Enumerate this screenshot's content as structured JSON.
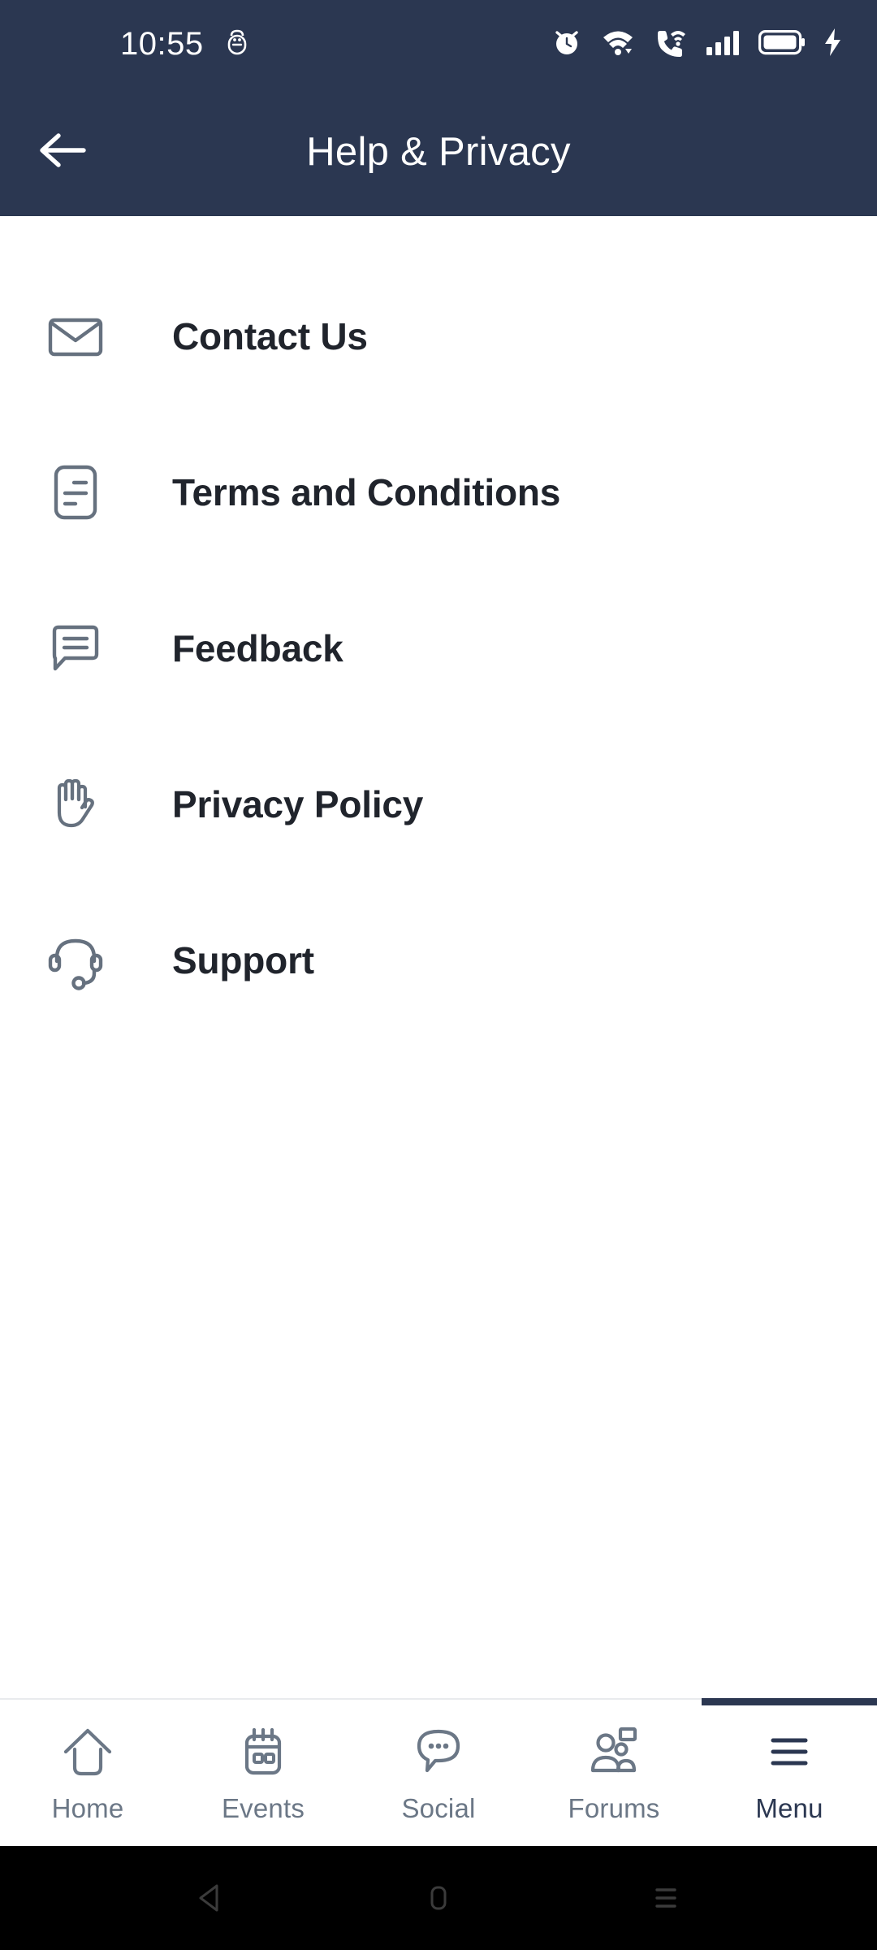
{
  "status_bar": {
    "time": "10:55",
    "icons": [
      {
        "name": "android-debug-icon"
      },
      {
        "name": "alarm-icon"
      },
      {
        "name": "wifi-icon"
      },
      {
        "name": "wifi-calling-icon"
      },
      {
        "name": "cellular-signal-icon"
      },
      {
        "name": "battery-icon"
      },
      {
        "name": "charging-bolt-icon"
      }
    ],
    "background_color": "#2b3751"
  },
  "app_bar": {
    "title": "Help & Privacy",
    "back_icon": "arrow-left-icon",
    "background_color": "#2b3751",
    "text_color": "#ffffff"
  },
  "menu": {
    "items": [
      {
        "label": "Contact Us",
        "icon": "envelope-icon"
      },
      {
        "label": "Terms and Conditions",
        "icon": "document-lines-icon"
      },
      {
        "label": "Feedback",
        "icon": "speech-bubble-lines-icon"
      },
      {
        "label": "Privacy Policy",
        "icon": "hand-palm-icon"
      },
      {
        "label": "Support",
        "icon": "headset-icon"
      }
    ],
    "icon_color": "#66717f",
    "label_color": "#20242c"
  },
  "bottom_nav": {
    "active_index": 4,
    "active_color": "#2b3751",
    "inactive_color": "#6b7786",
    "tabs": [
      {
        "label": "Home",
        "icon": "home-icon",
        "active": false
      },
      {
        "label": "Events",
        "icon": "calendar-icon",
        "active": false
      },
      {
        "label": "Social",
        "icon": "chat-dots-icon",
        "active": false
      },
      {
        "label": "Forums",
        "icon": "people-icon",
        "active": false
      },
      {
        "label": "Menu",
        "icon": "hamburger-icon",
        "active": true
      }
    ]
  },
  "android_nav": {
    "buttons": [
      {
        "name": "back-triangle-icon"
      },
      {
        "name": "home-square-icon"
      },
      {
        "name": "recents-lines-icon"
      }
    ],
    "background_color": "#000000",
    "icon_color": "#3b3b3b"
  }
}
